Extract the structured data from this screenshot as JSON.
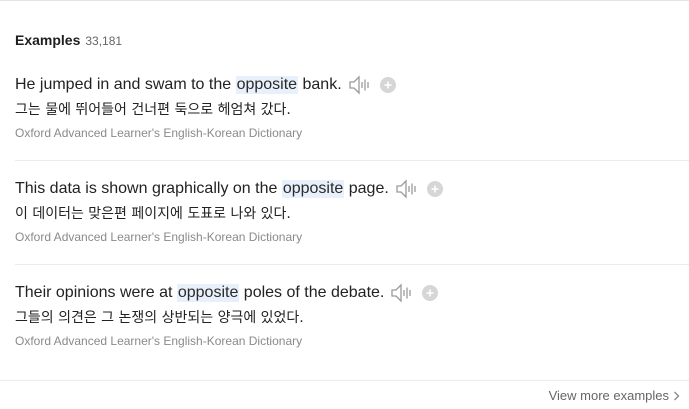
{
  "header": {
    "title": "Examples",
    "count": "33,181"
  },
  "examples": [
    {
      "before": "He jumped in and swam to the ",
      "highlight": "opposite",
      "after": " bank.",
      "korean": "그는 물에 뛰어들어 건너편 둑으로 헤엄쳐 갔다.",
      "source": "Oxford Advanced Learner's English-Korean Dictionary"
    },
    {
      "before": "This data is shown graphically on the ",
      "highlight": "opposite",
      "after": " page.",
      "korean": "이 데이터는 맞은편 페이지에 도표로 나와 있다.",
      "source": "Oxford Advanced Learner's English-Korean Dictionary"
    },
    {
      "before": "Their opinions were at ",
      "highlight": "opposite",
      "after": " poles of the debate.",
      "korean": "그들의 의견은 그 논쟁의 상반되는 양극에 있었다.",
      "source": "Oxford Advanced Learner's English-Korean Dictionary"
    }
  ],
  "footer": {
    "view_more_label": "View more examples"
  },
  "icons": {
    "speaker": "speaker-icon",
    "add": "plus-circle-icon",
    "chevron": "chevron-right-icon"
  },
  "colors": {
    "highlight_bg": "#e8f1fb",
    "source_text": "#8a8a8a",
    "icon_gray": "#9a9a9a"
  }
}
